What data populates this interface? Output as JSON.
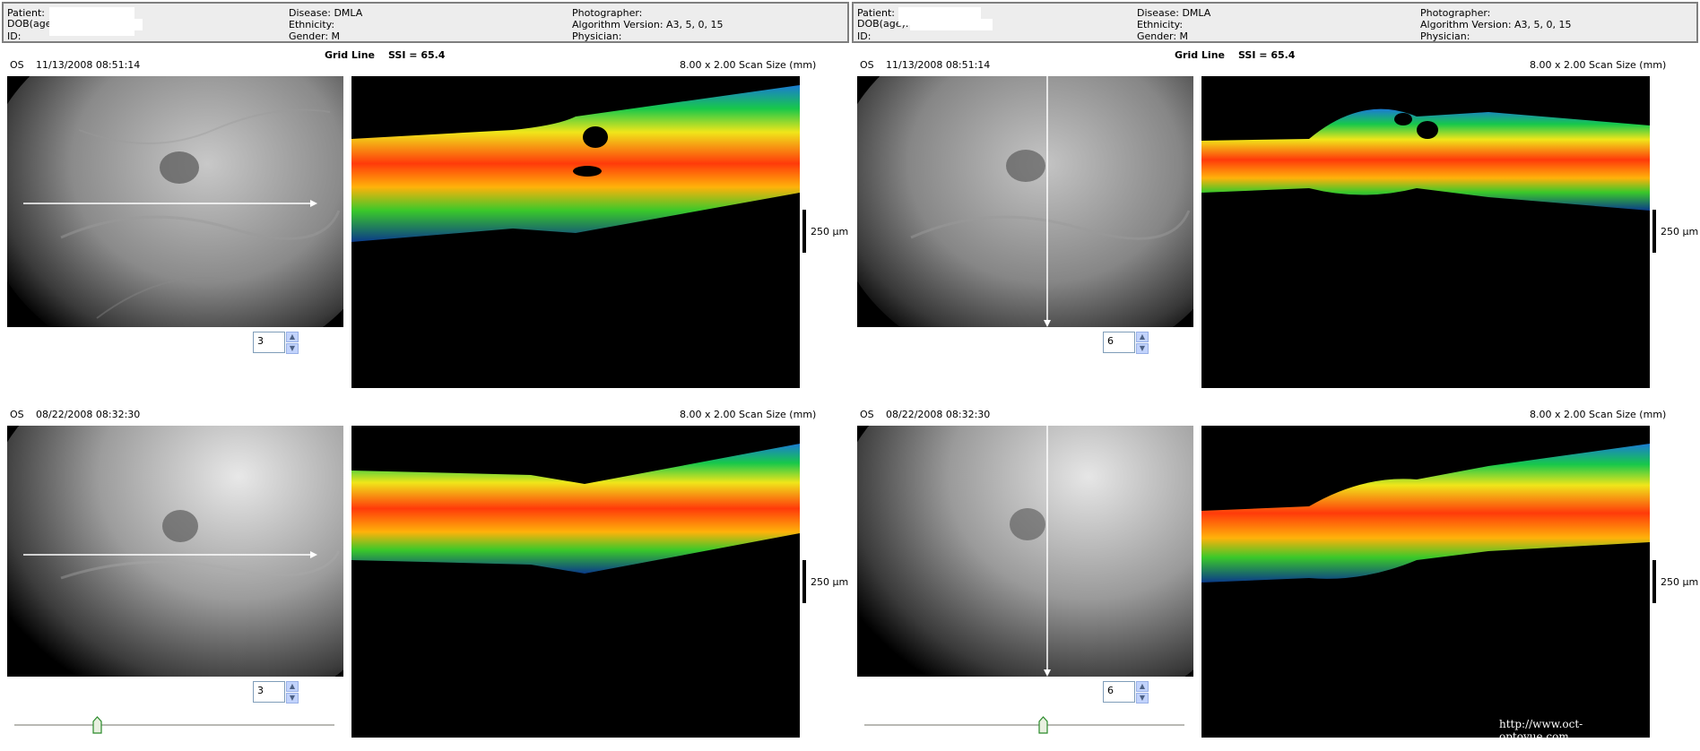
{
  "panels": [
    {
      "info": {
        "patient_label": "Patient:",
        "dob_label": "DOB(age):",
        "id_label": "ID:",
        "disease": "Disease: DMLA",
        "ethnicity": "Ethnicity:",
        "gender": "Gender: M",
        "photographer": "Photographer:",
        "algorithm": "Algorithm Version: A3, 5, 0, 15",
        "physician": "Physician:"
      },
      "scan_type": "Grid Line",
      "ssi": "SSI = 65.4",
      "orientation": "horizontal",
      "scans": [
        {
          "eye": "OS",
          "datetime": "11/13/2008 08:51:14",
          "scan_size": "8.00 x 2.00 Scan Size (mm)",
          "scale": "250 µm",
          "line_index": "3"
        },
        {
          "eye": "OS",
          "datetime": "08/22/2008 08:32:30",
          "scan_size": "8.00 x 2.00 Scan Size (mm)",
          "scale": "250 µm",
          "line_index": "3"
        }
      ],
      "slider_value": 0.25
    },
    {
      "info": {
        "patient_label": "Patient:",
        "dob_label": "DOB(age):",
        "id_label": "ID:",
        "disease": "Disease: DMLA",
        "ethnicity": "Ethnicity:",
        "gender": "Gender: M",
        "photographer": "Photographer:",
        "algorithm": "Algorithm Version: A3, 5, 0, 15",
        "physician": "Physician:"
      },
      "scan_type": "Grid Line",
      "ssi": "SSI = 65.4",
      "orientation": "vertical",
      "scans": [
        {
          "eye": "OS",
          "datetime": "11/13/2008 08:51:14",
          "scan_size": "8.00 x 2.00 Scan Size (mm)",
          "scale": "250 µm",
          "line_index": "6"
        },
        {
          "eye": "OS",
          "datetime": "08/22/2008 08:32:30",
          "scan_size": "8.00 x 2.00 Scan Size (mm)",
          "scale": "250 µm",
          "line_index": "6"
        }
      ],
      "slider_value": 0.56
    }
  ],
  "watermark": "http://www.oct-optovue.com",
  "colors": {
    "infobar_bg": "#ededed",
    "infobar_border": "#7f7f7f",
    "spinner_button": "#c2d3fc",
    "scan_line": "#ffffff"
  }
}
